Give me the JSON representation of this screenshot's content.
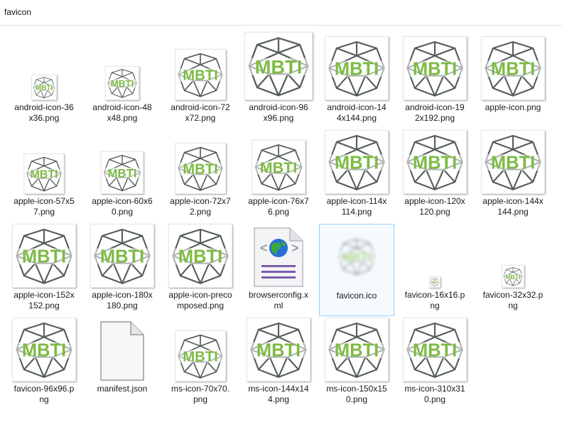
{
  "window": {
    "address_text": "favicon"
  },
  "colors": {
    "logo_green": "#7dbb44",
    "net_gray": "#555c5c",
    "selection": "#99d1ff"
  },
  "files": [
    {
      "name": "android-icon-36x36.png",
      "line1": "android-icon-36",
      "line2": "x36.png",
      "icon": "mbti-logo-icon"
    },
    {
      "name": "android-icon-48x48.png",
      "line1": "android-icon-48",
      "line2": "x48.png",
      "icon": "mbti-logo-icon"
    },
    {
      "name": "android-icon-72x72.png",
      "line1": "android-icon-72",
      "line2": "x72.png",
      "icon": "mbti-logo-icon"
    },
    {
      "name": "android-icon-96x96.png",
      "line1": "android-icon-96",
      "line2": "x96.png",
      "icon": "mbti-logo-icon"
    },
    {
      "name": "android-icon-144x144.png",
      "line1": "android-icon-14",
      "line2": "4x144.png",
      "icon": "mbti-logo-icon"
    },
    {
      "name": "android-icon-192x192.png",
      "line1": "android-icon-19",
      "line2": "2x192.png",
      "icon": "mbti-logo-icon"
    },
    {
      "name": "apple-icon.png",
      "line1": "apple-icon.png",
      "line2": "",
      "icon": "mbti-logo-icon"
    },
    {
      "name": "apple-icon-57x57.png",
      "line1": "apple-icon-57x5",
      "line2": "7.png",
      "icon": "mbti-logo-icon"
    },
    {
      "name": "apple-icon-60x60.png",
      "line1": "apple-icon-60x6",
      "line2": "0.png",
      "icon": "mbti-logo-icon"
    },
    {
      "name": "apple-icon-72x72.png",
      "line1": "apple-icon-72x7",
      "line2": "2.png",
      "icon": "mbti-logo-icon"
    },
    {
      "name": "apple-icon-76x76.png",
      "line1": "apple-icon-76x7",
      "line2": "6.png",
      "icon": "mbti-logo-icon"
    },
    {
      "name": "apple-icon-114x114.png",
      "line1": "apple-icon-114x",
      "line2": "114.png",
      "icon": "mbti-logo-icon"
    },
    {
      "name": "apple-icon-120x120.png",
      "line1": "apple-icon-120x",
      "line2": "120.png",
      "icon": "mbti-logo-icon"
    },
    {
      "name": "apple-icon-144x144.png",
      "line1": "apple-icon-144x",
      "line2": "144.png",
      "icon": "mbti-logo-icon"
    },
    {
      "name": "apple-icon-152x152.png",
      "line1": "apple-icon-152x",
      "line2": "152.png",
      "icon": "mbti-logo-icon"
    },
    {
      "name": "apple-icon-180x180.png",
      "line1": "apple-icon-180x",
      "line2": "180.png",
      "icon": "mbti-logo-icon"
    },
    {
      "name": "apple-icon-precomposed.png",
      "line1": "apple-icon-preco",
      "line2": "mposed.png",
      "icon": "mbti-logo-icon"
    },
    {
      "name": "browserconfig.xml",
      "line1": "browserconfig.x",
      "line2": "ml",
      "icon": "xml-globe-document-icon"
    },
    {
      "name": "favicon.ico",
      "line1": "favicon.ico",
      "line2": "",
      "icon": "blurred-mbti-logo-icon",
      "selected": true
    },
    {
      "name": "favicon-16x16.png",
      "line1": "favicon-16x16.p",
      "line2": "ng",
      "icon": "mbti-logo-icon"
    },
    {
      "name": "favicon-32x32.png",
      "line1": "favicon-32x32.p",
      "line2": "ng",
      "icon": "mbti-logo-icon"
    },
    {
      "name": "favicon-96x96.png",
      "line1": "favicon-96x96.p",
      "line2": "ng",
      "icon": "mbti-logo-icon"
    },
    {
      "name": "manifest.json",
      "line1": "manifest.json",
      "line2": "",
      "icon": "blank-document-icon"
    },
    {
      "name": "ms-icon-70x70.png",
      "line1": "ms-icon-70x70.",
      "line2": "png",
      "icon": "mbti-logo-icon"
    },
    {
      "name": "ms-icon-144x144.png",
      "line1": "ms-icon-144x14",
      "line2": "4.png",
      "icon": "mbti-logo-icon"
    },
    {
      "name": "ms-icon-150x150.png",
      "line1": "ms-icon-150x15",
      "line2": "0.png",
      "icon": "mbti-logo-icon"
    },
    {
      "name": "ms-icon-310x310.png",
      "line1": "ms-icon-310x31",
      "line2": "0.png",
      "icon": "mbti-logo-icon"
    }
  ],
  "logo": {
    "text": "MBTI"
  }
}
